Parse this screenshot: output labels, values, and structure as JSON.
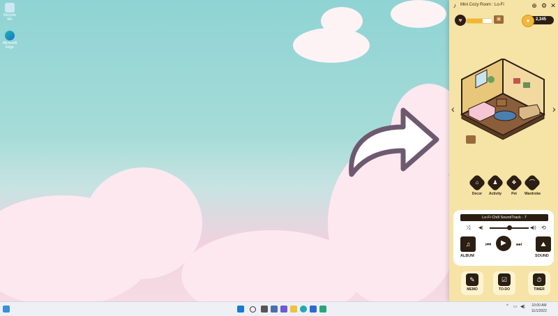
{
  "desktop": {
    "icons": [
      {
        "label": "Recycle Bin",
        "icon": "recycle-bin-icon"
      },
      {
        "label": "Microsoft Edge",
        "icon": "edge-icon"
      }
    ]
  },
  "app": {
    "title": "Mini Cozy Room : Lo-Fi",
    "window_buttons": {
      "pin": "⊕",
      "settings": "⚙",
      "close": "✕"
    },
    "hud": {
      "coins": "2,345",
      "energy_percent": 65
    },
    "categories": [
      {
        "label": "Decor",
        "glyph": "⌂"
      },
      {
        "label": "Activity",
        "glyph": "♟"
      },
      {
        "label": "Pet",
        "glyph": "❖"
      },
      {
        "label": "Wardrobe",
        "glyph": "⌒"
      }
    ],
    "player": {
      "track": "Lo-Fi Chill SoundTrack - 7",
      "album_label": "ALBUM",
      "sound_label": "SOUND",
      "volume_percent": 50,
      "controls": {
        "shuffle": "⤨",
        "vol_down": "◀)",
        "vol_up": "◀))",
        "repeat": "⟲",
        "prev": "⏮",
        "play": "▶",
        "next": "⏭"
      }
    },
    "tools": [
      {
        "label": "MEMO",
        "glyph": "✎"
      },
      {
        "label": "TO-DO",
        "glyph": "☑"
      },
      {
        "label": "TIMER",
        "glyph": "⏱"
      }
    ]
  },
  "taskbar": {
    "time": "10:00 AM",
    "date": "11/1/2022"
  },
  "colors": {
    "panel_bg": "#f6e3a6",
    "dark": "#2b1e12",
    "accent_gold": "#f2b73b"
  }
}
